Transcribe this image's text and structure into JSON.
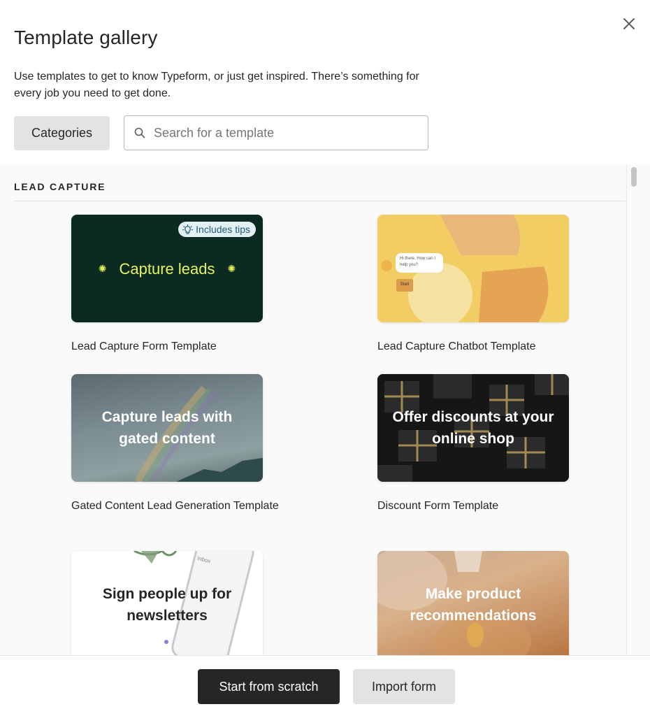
{
  "modal": {
    "title": "Template gallery",
    "description": "Use templates to get to know Typeform, or just get inspired. There’s something for every job you need to get done.",
    "close_icon": "close-icon"
  },
  "filters": {
    "categories_label": "Categories",
    "search_placeholder": "Search for a template",
    "search_value": ""
  },
  "section": {
    "heading": "LEAD CAPTURE",
    "cards": [
      {
        "thumb_text": "Capture leads",
        "label": "Lead Capture Form Template",
        "badge": "Includes tips"
      },
      {
        "thumb_text": "",
        "label": "Lead Capture Chatbot Template",
        "chat_bubble": "Hi there. How can I help you?",
        "chat_button": "Start"
      },
      {
        "thumb_text": "Capture leads with gated content",
        "label": "Gated Content Lead Generation Template"
      },
      {
        "thumb_text": "Offer discounts at your online shop",
        "label": "Discount Form Template"
      },
      {
        "thumb_text": "Sign people up for newsletters",
        "label": "",
        "phone_header": "Inbox"
      },
      {
        "thumb_text": "Make product recommendations",
        "label": ""
      }
    ]
  },
  "footer": {
    "start_label": "Start from scratch",
    "import_label": "Import form"
  },
  "colors": {
    "primary_button": "#262627",
    "secondary_button": "#e3e3e3",
    "lead_form_bg": "#0b2a22",
    "lead_form_text": "#e8f35c",
    "chatbot_bg": "#f2cd64"
  }
}
